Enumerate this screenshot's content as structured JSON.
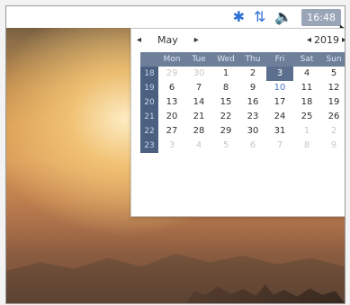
{
  "tray": {
    "bluetooth_icon": "bluetooth-icon",
    "network_icon": "network-arrows-icon",
    "volume_icon": "volume-icon",
    "clock_label": "16:48"
  },
  "calendar": {
    "month": "May",
    "year": "2019",
    "weekday_headers": [
      "Mon",
      "Tue",
      "Wed",
      "Thu",
      "Fri",
      "Sat",
      "Sun"
    ],
    "weeks": [
      {
        "num": "18",
        "days": [
          "29",
          "30",
          "1",
          "2",
          "3",
          "4",
          "5"
        ],
        "other": [
          true,
          true,
          false,
          false,
          false,
          false,
          false
        ],
        "blue": [
          false,
          false,
          false,
          false,
          false,
          false,
          false
        ],
        "selected": [
          false,
          false,
          false,
          false,
          true,
          false,
          false
        ]
      },
      {
        "num": "19",
        "days": [
          "6",
          "7",
          "8",
          "9",
          "10",
          "11",
          "12"
        ],
        "other": [
          false,
          false,
          false,
          false,
          false,
          false,
          false
        ],
        "blue": [
          false,
          false,
          false,
          false,
          true,
          false,
          false
        ],
        "selected": [
          false,
          false,
          false,
          false,
          false,
          false,
          false
        ]
      },
      {
        "num": "20",
        "days": [
          "13",
          "14",
          "15",
          "16",
          "17",
          "18",
          "19"
        ],
        "other": [
          false,
          false,
          false,
          false,
          false,
          false,
          false
        ],
        "blue": [
          false,
          false,
          false,
          false,
          false,
          false,
          false
        ],
        "selected": [
          false,
          false,
          false,
          false,
          false,
          false,
          false
        ]
      },
      {
        "num": "21",
        "days": [
          "20",
          "21",
          "22",
          "23",
          "24",
          "25",
          "26"
        ],
        "other": [
          false,
          false,
          false,
          false,
          false,
          false,
          false
        ],
        "blue": [
          false,
          false,
          false,
          false,
          false,
          false,
          false
        ],
        "selected": [
          false,
          false,
          false,
          false,
          false,
          false,
          false
        ]
      },
      {
        "num": "22",
        "days": [
          "27",
          "28",
          "29",
          "30",
          "31",
          "1",
          "2"
        ],
        "other": [
          false,
          false,
          false,
          false,
          false,
          true,
          true
        ],
        "blue": [
          false,
          false,
          false,
          false,
          false,
          false,
          false
        ],
        "selected": [
          false,
          false,
          false,
          false,
          false,
          false,
          false
        ]
      },
      {
        "num": "23",
        "days": [
          "3",
          "4",
          "5",
          "6",
          "7",
          "8",
          "9"
        ],
        "other": [
          true,
          true,
          true,
          true,
          true,
          true,
          true
        ],
        "blue": [
          false,
          false,
          false,
          false,
          false,
          false,
          false
        ],
        "selected": [
          false,
          false,
          false,
          false,
          false,
          false,
          false
        ]
      }
    ]
  }
}
